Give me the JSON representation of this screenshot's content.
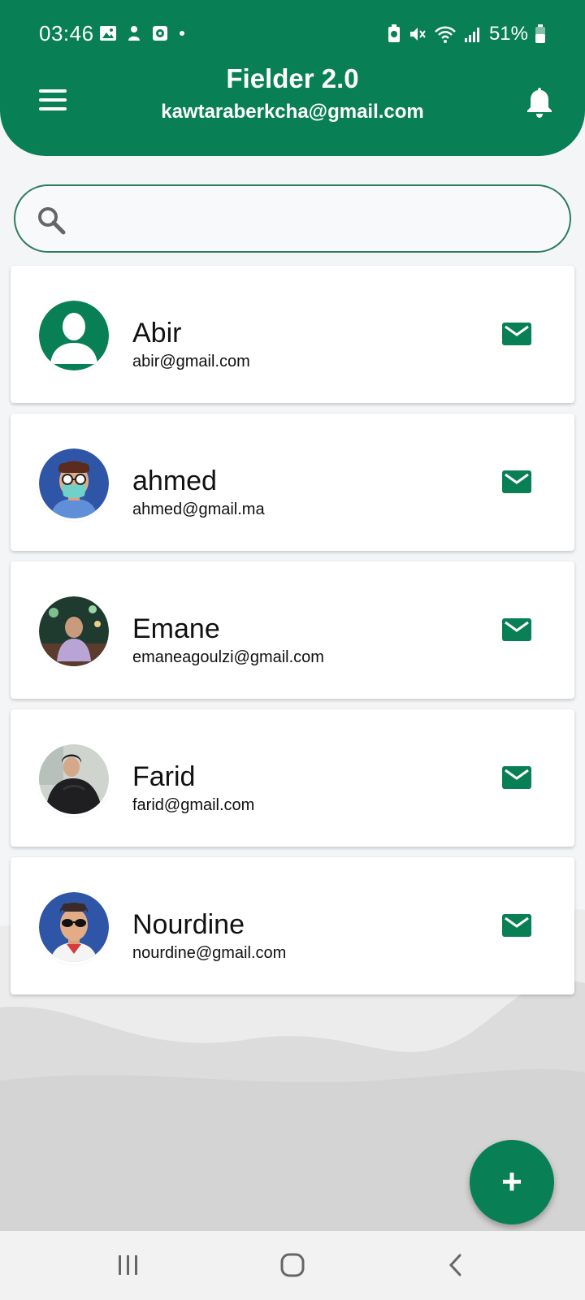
{
  "status_bar": {
    "time": "03:46",
    "battery": "51%"
  },
  "header": {
    "title": "Fielder 2.0",
    "subtitle": "kawtaraberkcha@gmail.com",
    "menu_icon": "hamburger-menu-icon",
    "bell_icon": "bell-icon"
  },
  "search": {
    "value": "",
    "icon": "search-icon"
  },
  "contacts": [
    {
      "name": "Abir",
      "email": "abir@gmail.com",
      "avatar": "default-person-avatar"
    },
    {
      "name": "ahmed",
      "email": "ahmed@gmail.ma",
      "avatar": "cartoon-glasses-mask-avatar"
    },
    {
      "name": "Emane",
      "email": "emaneagoulzi@gmail.com",
      "avatar": "photo-avatar"
    },
    {
      "name": "Farid",
      "email": "farid@gmail.com",
      "avatar": "photo-avatar"
    },
    {
      "name": "Nourdine",
      "email": "nourdine@gmail.com",
      "avatar": "cartoon-sunglasses-avatar"
    }
  ],
  "fab": {
    "label": "+"
  },
  "colors": {
    "primary": "#087f55",
    "card": "#ffffff",
    "background": "#f4f5f7"
  }
}
